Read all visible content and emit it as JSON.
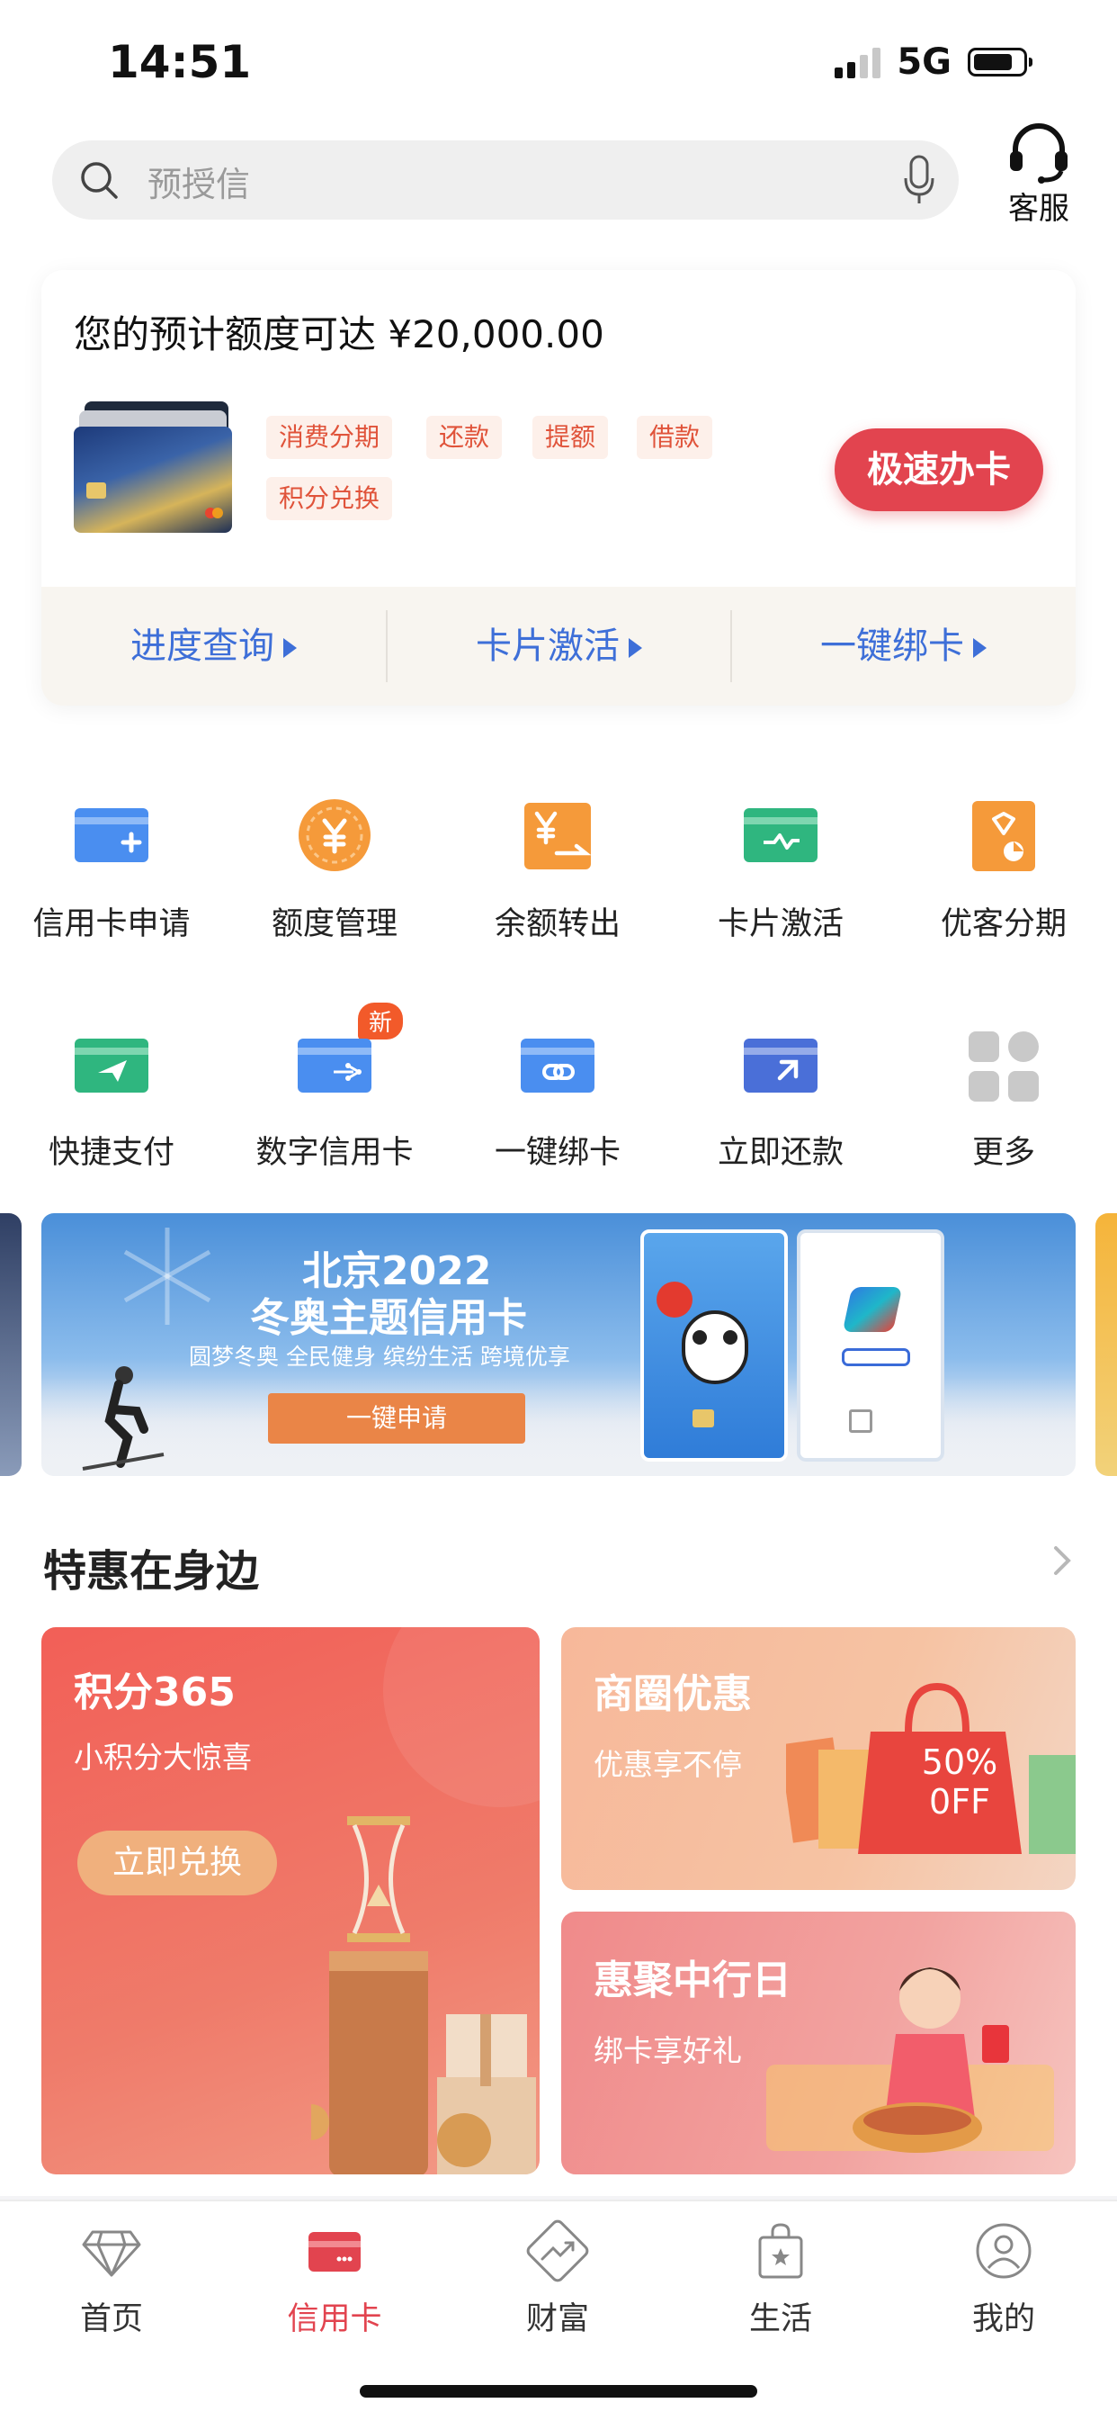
{
  "status_bar": {
    "time": "14:51",
    "network": "5G"
  },
  "search": {
    "placeholder": "预授信"
  },
  "customer_service": {
    "label": "客服"
  },
  "promo_card": {
    "title": "您的预计额度可达 ¥20,000.00",
    "tags": [
      "消费分期",
      "还款",
      "提额",
      "借款",
      "积分兑换"
    ],
    "apply_label": "极速办卡",
    "links": [
      "进度查询",
      "卡片激活",
      "一键绑卡"
    ]
  },
  "grid": {
    "items": [
      {
        "label": "信用卡申请",
        "icon": "card-add-icon"
      },
      {
        "label": "额度管理",
        "icon": "yuan-coin-icon"
      },
      {
        "label": "余额转出",
        "icon": "balance-transfer-icon"
      },
      {
        "label": "卡片激活",
        "icon": "card-activate-icon"
      },
      {
        "label": "优客分期",
        "icon": "installment-icon"
      },
      {
        "label": "快捷支付",
        "icon": "quick-pay-icon"
      },
      {
        "label": "数字信用卡",
        "icon": "digital-card-icon",
        "badge": "新"
      },
      {
        "label": "一键绑卡",
        "icon": "card-bind-icon"
      },
      {
        "label": "立即还款",
        "icon": "repay-icon"
      },
      {
        "label": "更多",
        "icon": "more-grid-icon"
      }
    ]
  },
  "banner": {
    "title_line1": "北京2022",
    "title_line2": "冬奥主题信用卡",
    "subtitle": "圆梦冬奥  全民健身  缤纷生活  跨境优享",
    "button": "一键申请"
  },
  "section": {
    "title": "特惠在身边",
    "tiles": [
      {
        "title": "积分365",
        "subtitle": "小积分大惊喜",
        "button": "立即兑换"
      },
      {
        "title": "商圈优惠",
        "subtitle": "优惠享不停",
        "art_text": "50%\n0FF"
      },
      {
        "title": "惠聚中行日",
        "subtitle": "绑卡享好礼"
      }
    ]
  },
  "tabbar": {
    "tabs": [
      {
        "label": "首页",
        "icon": "diamond-icon"
      },
      {
        "label": "信用卡",
        "icon": "credit-card-icon",
        "active": true
      },
      {
        "label": "财富",
        "icon": "wealth-chart-icon"
      },
      {
        "label": "生活",
        "icon": "shopping-bag-icon"
      },
      {
        "label": "我的",
        "icon": "user-profile-icon"
      }
    ]
  },
  "colors": {
    "accent_red": "#e2444f",
    "link_blue": "#3e6fd8",
    "tag_text": "#e0533a"
  }
}
